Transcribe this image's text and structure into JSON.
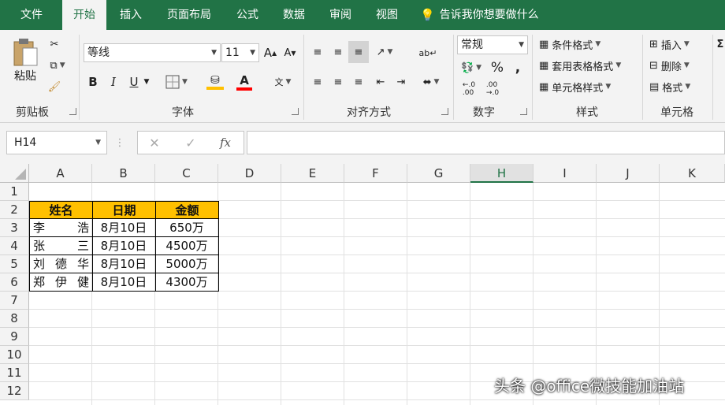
{
  "tabs": [
    "文件",
    "开始",
    "插入",
    "页面布局",
    "公式",
    "数据",
    "审阅",
    "视图"
  ],
  "tell_me": "告诉我你想要做什么",
  "ribbon": {
    "clipboard": {
      "paste": "粘贴",
      "label": "剪贴板"
    },
    "font": {
      "name": "等线",
      "size": "11",
      "label": "字体",
      "bold": "B",
      "italic": "I",
      "underline": "U",
      "grow": "A",
      "shrink": "A"
    },
    "alignment": {
      "label": "对齐方式"
    },
    "number": {
      "format": "常规",
      "label": "数字",
      "percent": "%",
      "comma": ","
    },
    "styles": {
      "conditional": "条件格式",
      "table": "套用表格格式",
      "cell_styles": "单元格样式",
      "label": "样式"
    },
    "cells": {
      "insert": "插入",
      "delete": "删除",
      "format": "格式",
      "label": "单元格"
    }
  },
  "formula_bar": {
    "name_box": "H14",
    "cancel": "✕",
    "enter": "✓",
    "fx": "fx",
    "formula": ""
  },
  "columns": [
    "A",
    "B",
    "C",
    "D",
    "E",
    "F",
    "G",
    "H",
    "I",
    "J",
    "K"
  ],
  "selected_column": "H",
  "rows": [
    "1",
    "2",
    "3",
    "4",
    "5",
    "6",
    "7",
    "8",
    "9",
    "10",
    "11",
    "12"
  ],
  "table": {
    "header": [
      "姓名",
      "日期",
      "金额"
    ],
    "rows": [
      [
        "李浩",
        "8月10日",
        "650万"
      ],
      [
        "张三",
        "8月10日",
        "4500万"
      ],
      [
        "刘德华",
        "8月10日",
        "5000万"
      ],
      [
        "郑伊健",
        "8月10日",
        "4300万"
      ]
    ]
  },
  "watermark": "头条 @office微技能加油站",
  "colors": {
    "excel_green": "#217346",
    "header_fill": "#ffc000"
  }
}
